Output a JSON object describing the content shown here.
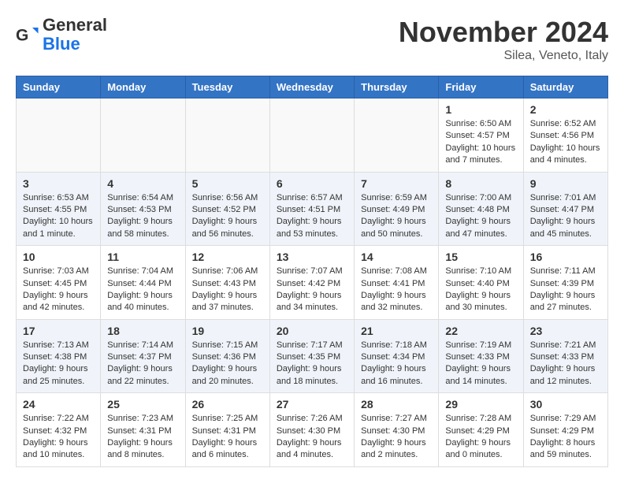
{
  "logo": {
    "line1": "General",
    "line2": "Blue"
  },
  "title": "November 2024",
  "location": "Silea, Veneto, Italy",
  "weekdays": [
    "Sunday",
    "Monday",
    "Tuesday",
    "Wednesday",
    "Thursday",
    "Friday",
    "Saturday"
  ],
  "weeks": [
    [
      {
        "day": "",
        "info": ""
      },
      {
        "day": "",
        "info": ""
      },
      {
        "day": "",
        "info": ""
      },
      {
        "day": "",
        "info": ""
      },
      {
        "day": "",
        "info": ""
      },
      {
        "day": "1",
        "info": "Sunrise: 6:50 AM\nSunset: 4:57 PM\nDaylight: 10 hours\nand 7 minutes."
      },
      {
        "day": "2",
        "info": "Sunrise: 6:52 AM\nSunset: 4:56 PM\nDaylight: 10 hours\nand 4 minutes."
      }
    ],
    [
      {
        "day": "3",
        "info": "Sunrise: 6:53 AM\nSunset: 4:55 PM\nDaylight: 10 hours\nand 1 minute."
      },
      {
        "day": "4",
        "info": "Sunrise: 6:54 AM\nSunset: 4:53 PM\nDaylight: 9 hours\nand 58 minutes."
      },
      {
        "day": "5",
        "info": "Sunrise: 6:56 AM\nSunset: 4:52 PM\nDaylight: 9 hours\nand 56 minutes."
      },
      {
        "day": "6",
        "info": "Sunrise: 6:57 AM\nSunset: 4:51 PM\nDaylight: 9 hours\nand 53 minutes."
      },
      {
        "day": "7",
        "info": "Sunrise: 6:59 AM\nSunset: 4:49 PM\nDaylight: 9 hours\nand 50 minutes."
      },
      {
        "day": "8",
        "info": "Sunrise: 7:00 AM\nSunset: 4:48 PM\nDaylight: 9 hours\nand 47 minutes."
      },
      {
        "day": "9",
        "info": "Sunrise: 7:01 AM\nSunset: 4:47 PM\nDaylight: 9 hours\nand 45 minutes."
      }
    ],
    [
      {
        "day": "10",
        "info": "Sunrise: 7:03 AM\nSunset: 4:45 PM\nDaylight: 9 hours\nand 42 minutes."
      },
      {
        "day": "11",
        "info": "Sunrise: 7:04 AM\nSunset: 4:44 PM\nDaylight: 9 hours\nand 40 minutes."
      },
      {
        "day": "12",
        "info": "Sunrise: 7:06 AM\nSunset: 4:43 PM\nDaylight: 9 hours\nand 37 minutes."
      },
      {
        "day": "13",
        "info": "Sunrise: 7:07 AM\nSunset: 4:42 PM\nDaylight: 9 hours\nand 34 minutes."
      },
      {
        "day": "14",
        "info": "Sunrise: 7:08 AM\nSunset: 4:41 PM\nDaylight: 9 hours\nand 32 minutes."
      },
      {
        "day": "15",
        "info": "Sunrise: 7:10 AM\nSunset: 4:40 PM\nDaylight: 9 hours\nand 30 minutes."
      },
      {
        "day": "16",
        "info": "Sunrise: 7:11 AM\nSunset: 4:39 PM\nDaylight: 9 hours\nand 27 minutes."
      }
    ],
    [
      {
        "day": "17",
        "info": "Sunrise: 7:13 AM\nSunset: 4:38 PM\nDaylight: 9 hours\nand 25 minutes."
      },
      {
        "day": "18",
        "info": "Sunrise: 7:14 AM\nSunset: 4:37 PM\nDaylight: 9 hours\nand 22 minutes."
      },
      {
        "day": "19",
        "info": "Sunrise: 7:15 AM\nSunset: 4:36 PM\nDaylight: 9 hours\nand 20 minutes."
      },
      {
        "day": "20",
        "info": "Sunrise: 7:17 AM\nSunset: 4:35 PM\nDaylight: 9 hours\nand 18 minutes."
      },
      {
        "day": "21",
        "info": "Sunrise: 7:18 AM\nSunset: 4:34 PM\nDaylight: 9 hours\nand 16 minutes."
      },
      {
        "day": "22",
        "info": "Sunrise: 7:19 AM\nSunset: 4:33 PM\nDaylight: 9 hours\nand 14 minutes."
      },
      {
        "day": "23",
        "info": "Sunrise: 7:21 AM\nSunset: 4:33 PM\nDaylight: 9 hours\nand 12 minutes."
      }
    ],
    [
      {
        "day": "24",
        "info": "Sunrise: 7:22 AM\nSunset: 4:32 PM\nDaylight: 9 hours\nand 10 minutes."
      },
      {
        "day": "25",
        "info": "Sunrise: 7:23 AM\nSunset: 4:31 PM\nDaylight: 9 hours\nand 8 minutes."
      },
      {
        "day": "26",
        "info": "Sunrise: 7:25 AM\nSunset: 4:31 PM\nDaylight: 9 hours\nand 6 minutes."
      },
      {
        "day": "27",
        "info": "Sunrise: 7:26 AM\nSunset: 4:30 PM\nDaylight: 9 hours\nand 4 minutes."
      },
      {
        "day": "28",
        "info": "Sunrise: 7:27 AM\nSunset: 4:30 PM\nDaylight: 9 hours\nand 2 minutes."
      },
      {
        "day": "29",
        "info": "Sunrise: 7:28 AM\nSunset: 4:29 PM\nDaylight: 9 hours\nand 0 minutes."
      },
      {
        "day": "30",
        "info": "Sunrise: 7:29 AM\nSunset: 4:29 PM\nDaylight: 8 hours\nand 59 minutes."
      }
    ]
  ]
}
